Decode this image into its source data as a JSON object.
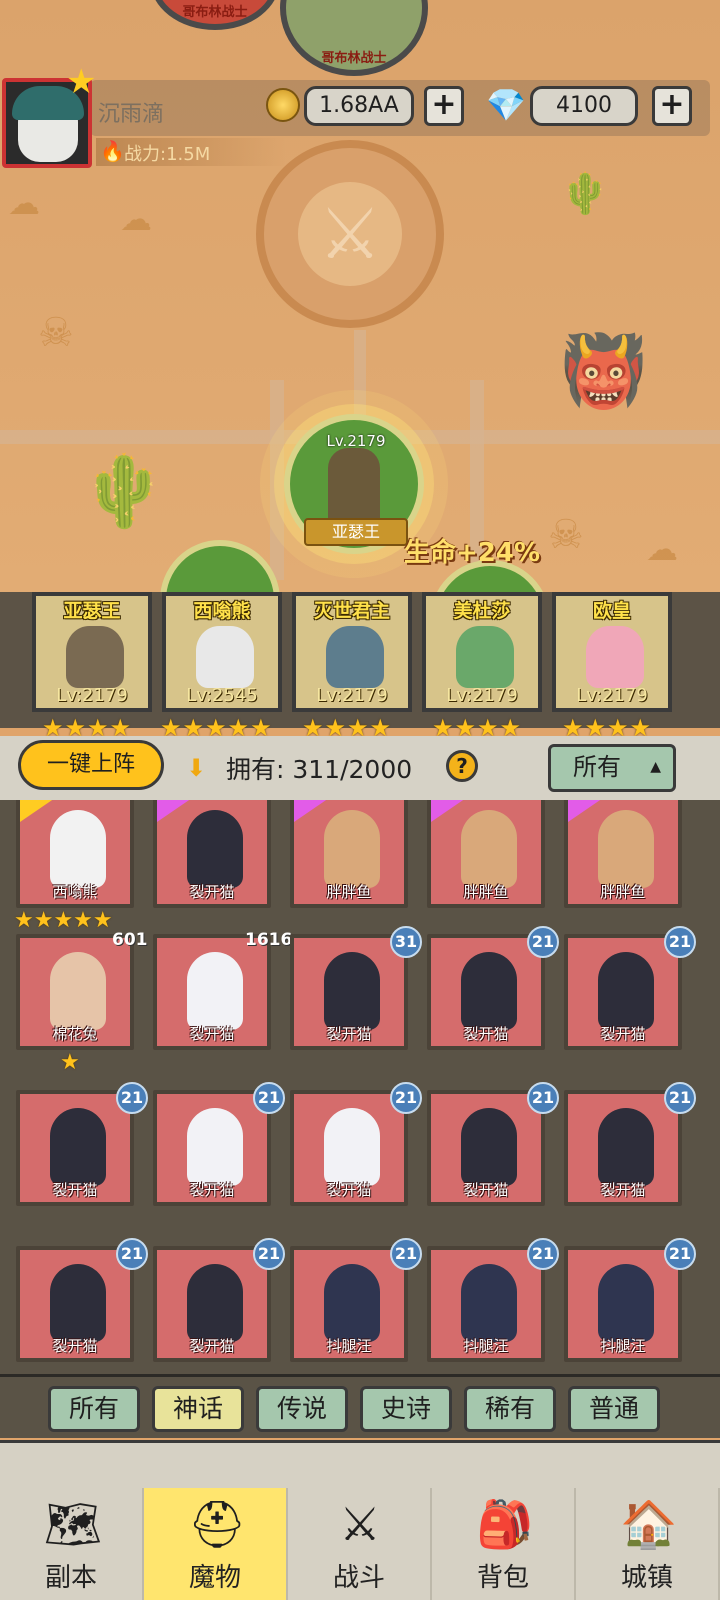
{
  "map": {
    "top_nodes": [
      {
        "label": "哥布林战士"
      },
      {
        "label": "哥布林战士"
      }
    ],
    "current_stage": {
      "name": "亚瑟王",
      "level": "Lv.2179"
    },
    "buff_text": "生命+24%"
  },
  "header": {
    "player_name": "沉雨滴",
    "gold": "1.68AA",
    "diamonds": "4100",
    "power": "战力:1.5M",
    "icons": {
      "gold": "gold-coin-icon",
      "diamond": "diamond-icon",
      "power": "flame-icon"
    }
  },
  "lineup": [
    {
      "name": "亚瑟王",
      "level": "Lv:2179",
      "stars": "★★★★",
      "color": "#7a6a52"
    },
    {
      "name": "西嗡熊",
      "level": "Lv:2545",
      "stars": "★★★★★",
      "color": "#e8e8e8"
    },
    {
      "name": "灭世君主",
      "level": "Lv:2179",
      "stars": "★★★★",
      "color": "#5d7d8d"
    },
    {
      "name": "美杜莎",
      "level": "Lv:2179",
      "stars": "★★★★",
      "color": "#6aa86a"
    },
    {
      "name": "欧皇",
      "level": "Lv:2179",
      "stars": "★★★★",
      "color": "#f0a7b8"
    }
  ],
  "toolbar": {
    "deploy_label": "一键上阵",
    "owned_label": "拥有: 311/2000",
    "help_label": "?",
    "filter_label": "所有"
  },
  "monsters": [
    {
      "name": "西嗡熊",
      "badge": "",
      "stars": "★★★★★",
      "ribbon": "#ffcc22",
      "fig": "#f2f2f2"
    },
    {
      "name": "裂开猫",
      "badge": "",
      "stars": "",
      "ribbon": "#e25ce8",
      "fig": "#2d2d3a"
    },
    {
      "name": "胖胖鱼",
      "badge": "",
      "stars": "",
      "ribbon": "#e25ce8",
      "fig": "#d9a87a"
    },
    {
      "name": "胖胖鱼",
      "badge": "",
      "stars": "",
      "ribbon": "#e25ce8",
      "fig": "#d9a87a"
    },
    {
      "name": "胖胖鱼",
      "badge": "",
      "stars": "",
      "ribbon": "#e25ce8",
      "fig": "#d9a87a"
    },
    {
      "name": "棉花兔",
      "badge": "601",
      "stars": "★",
      "ribbon": "",
      "fig": "#e6c4a8"
    },
    {
      "name": "裂开猫",
      "badge": "1616",
      "stars": "",
      "ribbon": "",
      "fig": "#f2f2f6"
    },
    {
      "name": "裂开猫",
      "badge": "31",
      "stars": "",
      "ribbon": "",
      "fig": "#2d2d3a"
    },
    {
      "name": "裂开猫",
      "badge": "21",
      "stars": "",
      "ribbon": "",
      "fig": "#2d2d3a"
    },
    {
      "name": "裂开猫",
      "badge": "21",
      "stars": "",
      "ribbon": "",
      "fig": "#2d2d3a"
    },
    {
      "name": "裂开猫",
      "badge": "21",
      "stars": "",
      "ribbon": "",
      "fig": "#2d2d3a"
    },
    {
      "name": "裂开猫",
      "badge": "21",
      "stars": "",
      "ribbon": "",
      "fig": "#f2f2f6"
    },
    {
      "name": "裂开猫",
      "badge": "21",
      "stars": "",
      "ribbon": "",
      "fig": "#f2f2f6"
    },
    {
      "name": "裂开猫",
      "badge": "21",
      "stars": "",
      "ribbon": "",
      "fig": "#2d2d3a"
    },
    {
      "name": "裂开猫",
      "badge": "21",
      "stars": "",
      "ribbon": "",
      "fig": "#2d2d3a"
    },
    {
      "name": "裂开猫",
      "badge": "21",
      "stars": "",
      "ribbon": "",
      "fig": "#2d2d3a"
    },
    {
      "name": "裂开猫",
      "badge": "21",
      "stars": "",
      "ribbon": "",
      "fig": "#2d2d3a"
    },
    {
      "name": "抖腿汪",
      "badge": "21",
      "stars": "",
      "ribbon": "",
      "fig": "#2f3550"
    },
    {
      "name": "抖腿汪",
      "badge": "21",
      "stars": "",
      "ribbon": "",
      "fig": "#2f3550"
    },
    {
      "name": "抖腿汪",
      "badge": "21",
      "stars": "",
      "ribbon": "",
      "fig": "#2f3550"
    }
  ],
  "rarity_tabs": [
    {
      "label": "所有",
      "active": false
    },
    {
      "label": "神话",
      "active": true
    },
    {
      "label": "传说",
      "active": false
    },
    {
      "label": "史诗",
      "active": false
    },
    {
      "label": "稀有",
      "active": false
    },
    {
      "label": "普通",
      "active": false
    }
  ],
  "bottom_nav": [
    {
      "label": "副本",
      "icon": "map-scroll-icon",
      "glyph": "🗺",
      "active": false
    },
    {
      "label": "魔物",
      "icon": "monster-helmet-icon",
      "glyph": "⛑",
      "active": true
    },
    {
      "label": "战斗",
      "icon": "crossed-swords-icon",
      "glyph": "⚔",
      "active": false
    },
    {
      "label": "背包",
      "icon": "backpack-icon",
      "glyph": "🎒",
      "active": false
    },
    {
      "label": "城镇",
      "icon": "town-shop-icon",
      "glyph": "🏠",
      "active": false
    }
  ]
}
